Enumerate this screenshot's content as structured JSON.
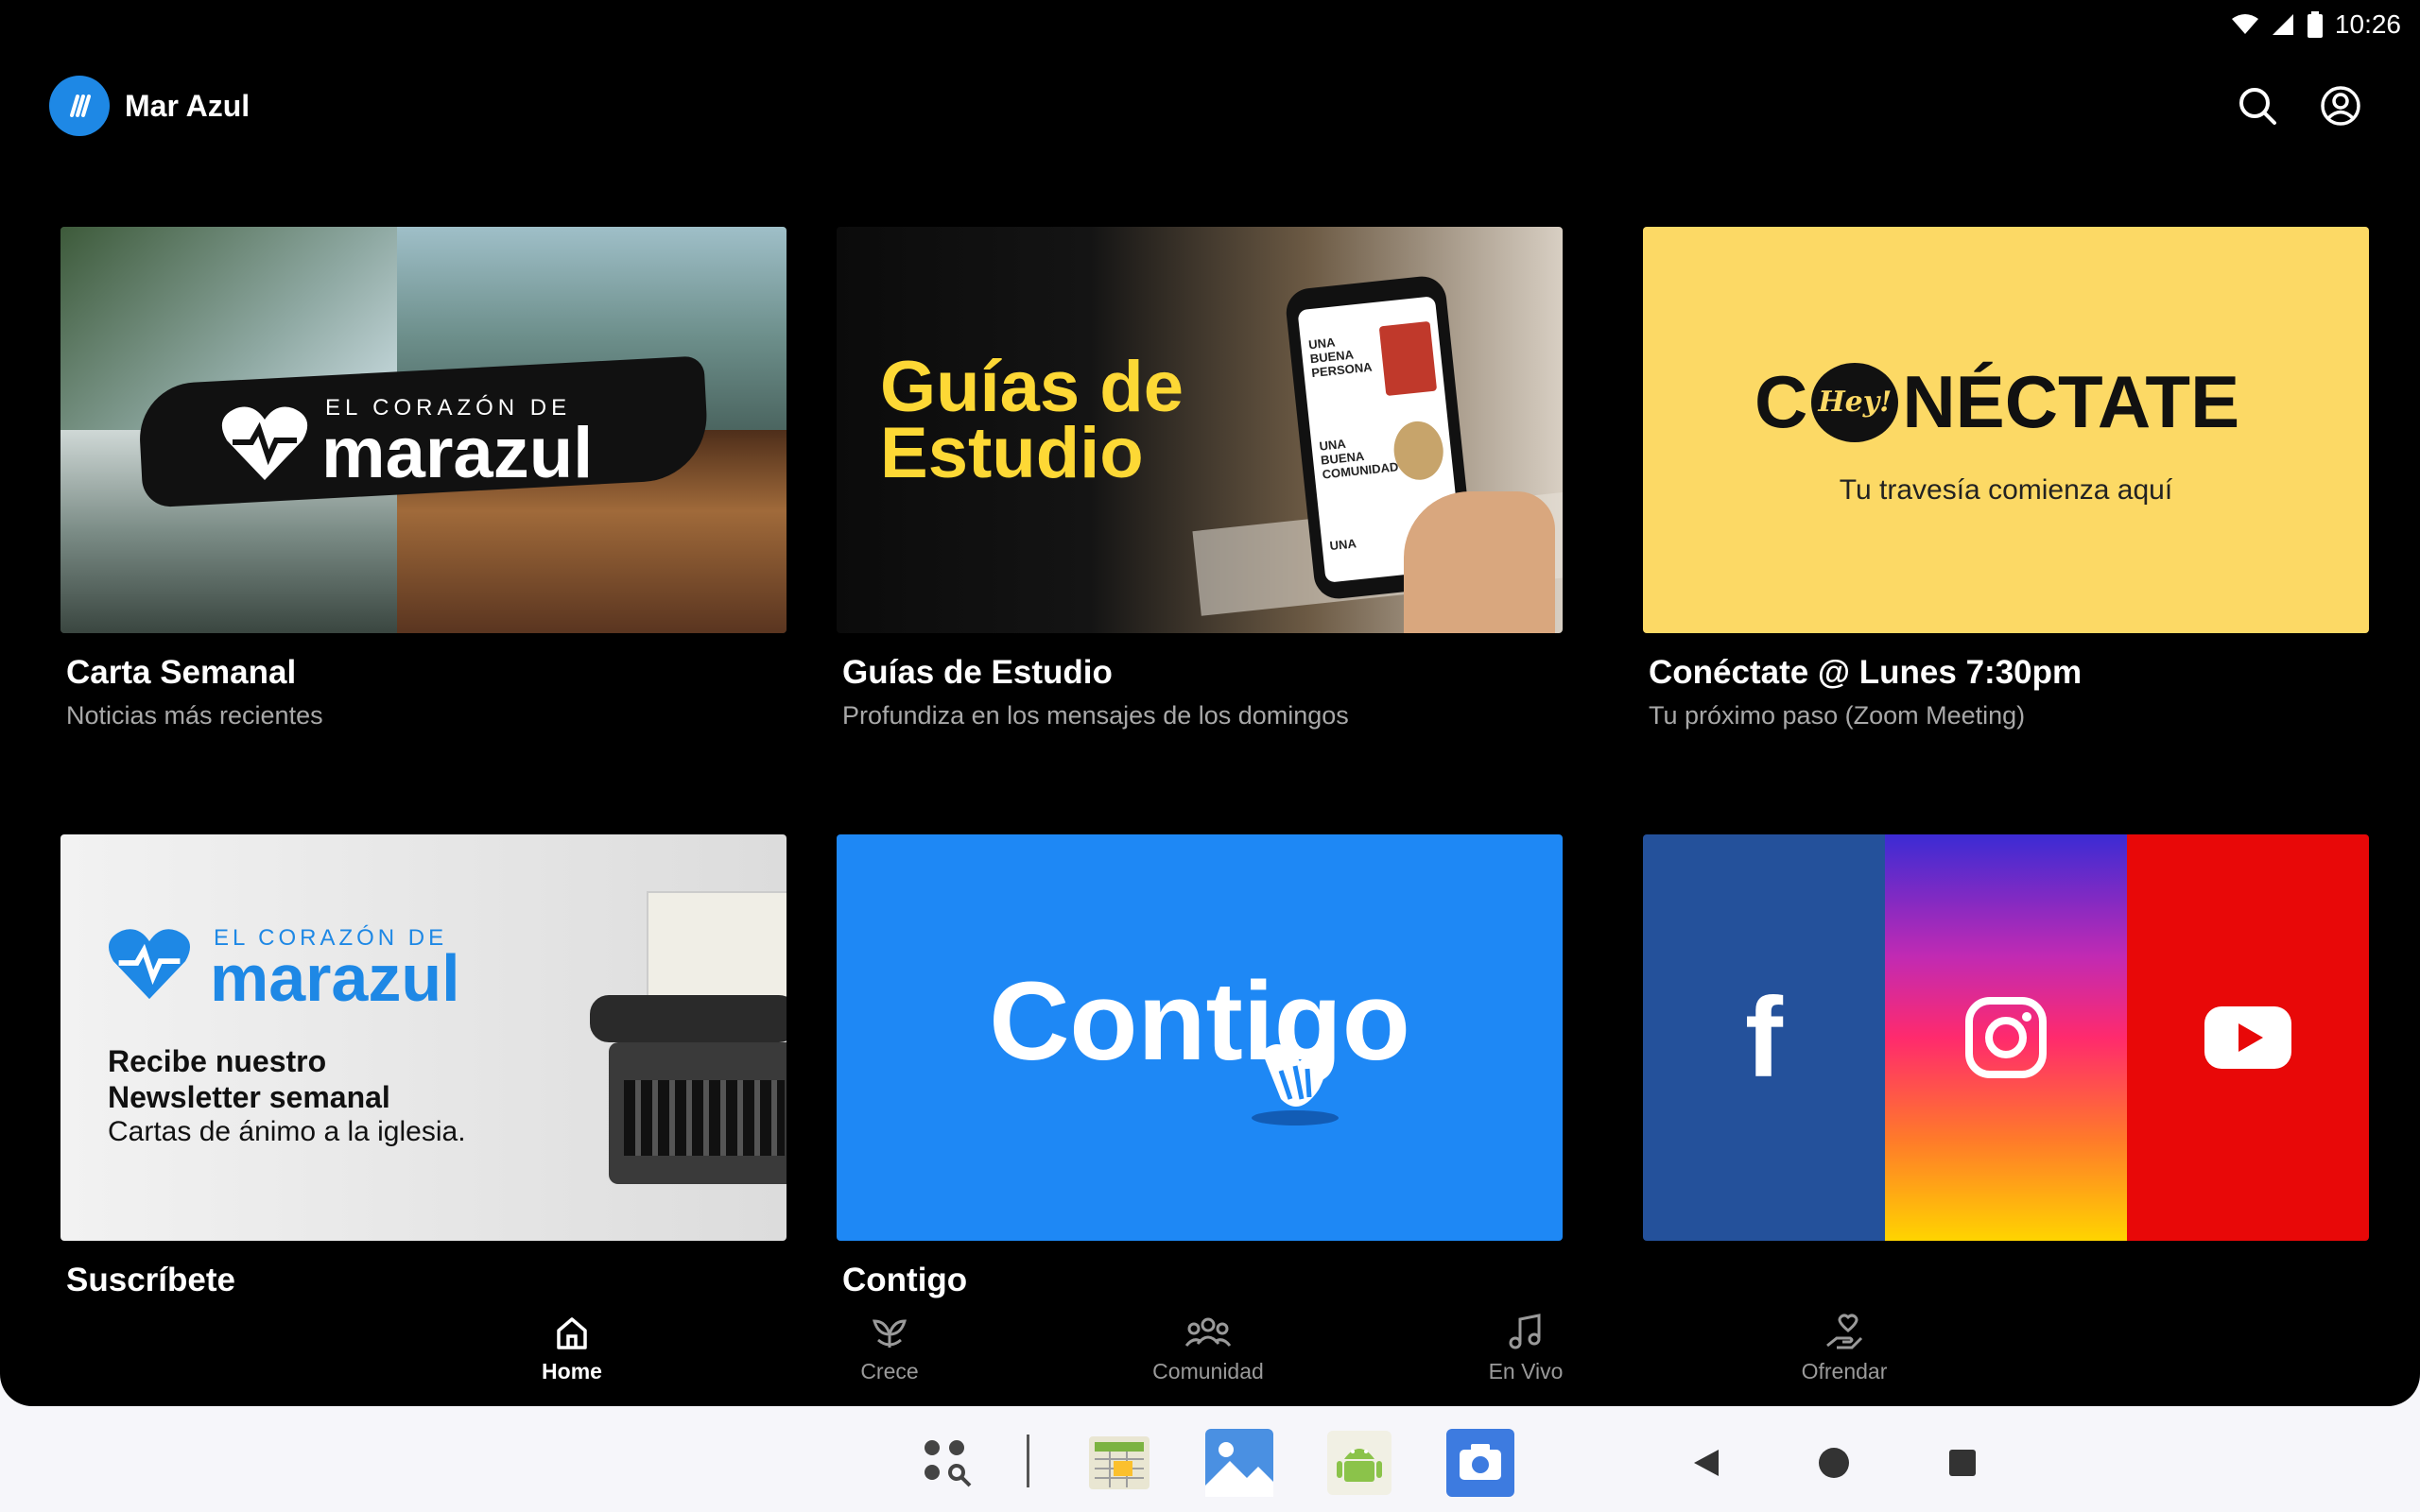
{
  "status_bar": {
    "time": "10:26"
  },
  "header": {
    "app_name": "Mar Azul"
  },
  "cards": [
    {
      "title": "Carta Semanal",
      "subtitle": "Noticias más recientes",
      "banner": {
        "line1": "EL CORAZÓN DE",
        "line2": "marazul"
      }
    },
    {
      "title": "Guías de Estudio",
      "subtitle": "Profundiza en los mensajes de los domingos",
      "banner": {
        "line1": "Guías de",
        "line2": "Estudio",
        "phone_1": "UNA BUENA PERSONA",
        "phone_2": "UNA BUENA COMUNIDAD",
        "phone_3": "UNA"
      }
    },
    {
      "title": "Conéctate @ Lunes 7:30pm",
      "subtitle": "Tu próximo paso (Zoom Meeting)",
      "banner": {
        "pre": "C",
        "bubble": "Hey!",
        "post": "NÉCTATE",
        "tagline": "Tu travesía comienza aquí"
      }
    },
    {
      "title": "Suscríbete",
      "subtitle": "",
      "banner": {
        "line1": "EL CORAZÓN DE",
        "line2": "marazul",
        "promo_1": "Recibe nuestro",
        "promo_2": "Newsletter semanal",
        "promo_3": "Cartas de ánimo a la iglesia."
      }
    },
    {
      "title": "Contigo",
      "subtitle": "",
      "banner": {
        "word": "Contigo"
      }
    },
    {
      "title": "",
      "subtitle": "",
      "banner": {
        "facebook": "f"
      }
    }
  ],
  "bottom_nav": [
    {
      "label": "Home",
      "icon": "home-icon",
      "active": true
    },
    {
      "label": "Crece",
      "icon": "sprout-icon",
      "active": false
    },
    {
      "label": "Comunidad",
      "icon": "group-icon",
      "active": false
    },
    {
      "label": "En Vivo",
      "icon": "music-note-icon",
      "active": false
    },
    {
      "label": "Ofrendar",
      "icon": "give-hand-icon",
      "active": false
    }
  ],
  "colors": {
    "accent": "#1e88e5",
    "yellow": "#fcd965",
    "blue": "#1e88f5",
    "facebook": "#24519b",
    "youtube": "#e80808"
  }
}
